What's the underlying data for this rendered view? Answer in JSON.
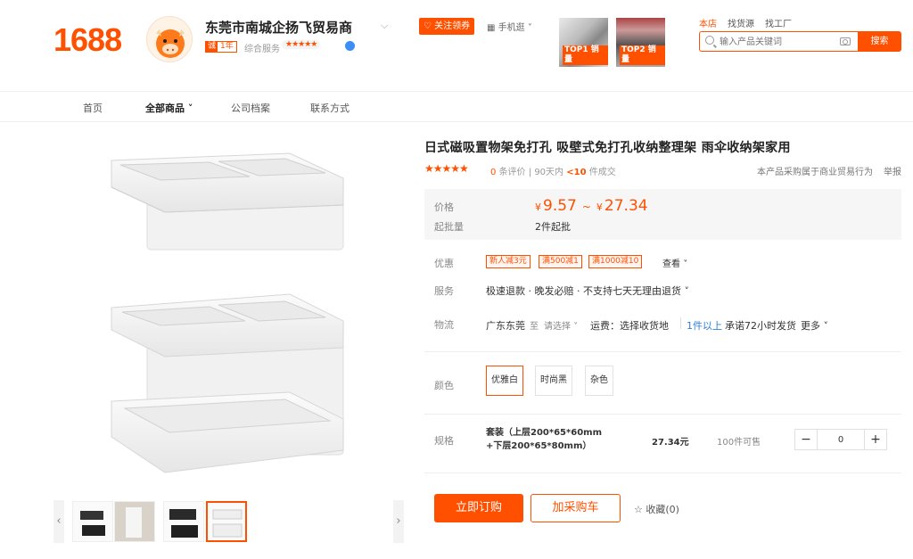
{
  "header": {
    "logo": "1688",
    "shop_name": "东莞市南城企扬飞贸易商",
    "shop_years_icon": "诚",
    "shop_years": "1年",
    "rating_label": "综合服务",
    "rating_stars": "★★★★★",
    "follow_label": "关注领券",
    "mobile_label": "手机逛",
    "top_tags": [
      "TOP1 销量",
      "TOP2 销量"
    ],
    "nav_links": [
      "本店",
      "找货源",
      "找工厂"
    ],
    "search_placeholder": "输入产品关键词",
    "search_button": "搜索"
  },
  "subnav": {
    "items": [
      "首页",
      "全部商品",
      "公司档案",
      "联系方式"
    ]
  },
  "product": {
    "title": "日式磁吸置物架免打孔 吸壁式免打孔收纳整理架 雨伞收纳架家用",
    "stars": "★★★★★",
    "reviews_count": "0",
    "reviews_label": "条评价",
    "sold_period": "90天内",
    "sold_count": "<10",
    "sold_label": "件成交",
    "biz_note": "本产品采购属于商业贸易行为",
    "report": "举报",
    "price_label": "价格",
    "currency": "¥",
    "price_low": "9.57",
    "price_sep": "~",
    "price_high": "27.34",
    "moq_label": "起批量",
    "moq": "2件起批",
    "promo_label": "优惠",
    "promos": [
      "新人减3元",
      "满500减1",
      "满1000减10"
    ],
    "promo_view": "查看",
    "service_label": "服务",
    "service_text": "极速退款 · 晚发必赔 · 不支持七天无理由退货",
    "logistics_label": "物流",
    "logi_from": "广东东莞",
    "logi_to": "至",
    "logi_select": "请选择",
    "logi_freight": "运费：选择收货地",
    "logi_min": "1件以上",
    "logi_promise": "承诺72小时发货",
    "logi_more": "更多",
    "color_label": "颜色",
    "colors": [
      "优雅白",
      "时尚黑",
      "杂色"
    ],
    "spec_label": "规格",
    "spec_name_line1": "套装（上层200*65*60mm",
    "spec_name_line2": "+下层200*65*80mm）",
    "spec_price": "27.34元",
    "spec_stock": "100件可售",
    "qty_minus": "−",
    "qty_value": "0",
    "qty_plus": "+",
    "btn_order": "立即订购",
    "btn_cart": "加采购车",
    "favorite": "收藏(0)"
  }
}
